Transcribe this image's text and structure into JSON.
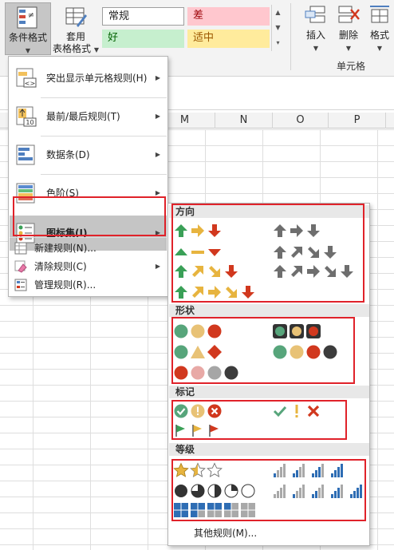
{
  "ribbon": {
    "conditional_formatting": {
      "line1": "条件格式",
      "arrow": "▼"
    },
    "table_format": {
      "line1": "套用",
      "line2": "表格格式",
      "arrow": "▼"
    },
    "styles": {
      "normal": "常规",
      "bad": "差",
      "good": "好",
      "neutral": "适中"
    },
    "insert": {
      "label": "插入",
      "arrow": "▼"
    },
    "delete": {
      "label": "删除",
      "arrow": "▼"
    },
    "format": {
      "label": "格式",
      "arrow": "▼"
    },
    "cells_group_label": "单元格"
  },
  "grid": {
    "columns": [
      "M",
      "N",
      "O",
      "P"
    ]
  },
  "menu": {
    "items": [
      {
        "label": "突出显示单元格规则(H)",
        "icon": "highlight-cells-icon"
      },
      {
        "label": "最前/最后规则(T)",
        "icon": "top-bottom-icon"
      },
      {
        "label": "数据条(D)",
        "icon": "data-bars-icon"
      },
      {
        "label": "色阶(S)",
        "icon": "color-scales-icon"
      },
      {
        "label": "图标集(I)",
        "icon": "icon-sets-icon"
      }
    ],
    "small_items": [
      {
        "label": "新建规则(N)...",
        "icon": "new-rule-icon"
      },
      {
        "label": "清除规则(C)",
        "icon": "clear-rules-icon"
      },
      {
        "label": "管理规则(R)...",
        "icon": "manage-rules-icon"
      }
    ],
    "submenu_arrow": "▶"
  },
  "iconsets": {
    "sections": [
      "方向",
      "形状",
      "标记",
      "等级"
    ],
    "more_rules": "其他规则(M)..."
  },
  "colors": {
    "green": "#3aa057",
    "yellow": "#e7b43f",
    "red": "#d1381e",
    "gray": "#6e6e6e",
    "highlight_box": "#e0222a"
  }
}
